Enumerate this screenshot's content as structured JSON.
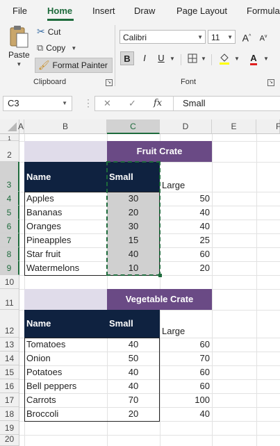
{
  "ribbon_tabs": [
    {
      "label": "File"
    },
    {
      "label": "Home"
    },
    {
      "label": "Insert"
    },
    {
      "label": "Draw"
    },
    {
      "label": "Page Layout"
    },
    {
      "label": "Formula"
    }
  ],
  "clipboard": {
    "paste": "Paste",
    "cut": "Cut",
    "copy": "Copy",
    "format_painter": "Format Painter",
    "group_label": "Clipboard"
  },
  "font": {
    "name": "Calibri",
    "size": "11",
    "grow": "A",
    "shrink": "A",
    "bold": "B",
    "italic": "I",
    "underline": "U",
    "color_letter": "A",
    "group_label": "Font"
  },
  "formula_bar": {
    "name_box": "C3",
    "cancel": "✕",
    "enter": "✓",
    "fx": "fx",
    "value": "Small"
  },
  "columns": [
    "A",
    "B",
    "C",
    "D",
    "E",
    "F"
  ],
  "rows": [
    "1",
    "2",
    "3",
    "4",
    "5",
    "6",
    "7",
    "8",
    "9",
    "10",
    "11",
    "12",
    "13",
    "14",
    "15",
    "16",
    "17",
    "18",
    "19",
    "20"
  ],
  "fruit": {
    "title": "Fruit Crate",
    "headers": [
      "Name",
      "Small",
      "Large"
    ],
    "rows": [
      {
        "name": "Apples",
        "small": "30",
        "large": "50"
      },
      {
        "name": "Bananas",
        "small": "20",
        "large": "40"
      },
      {
        "name": "Oranges",
        "small": "30",
        "large": "40"
      },
      {
        "name": "Pineapples",
        "small": "15",
        "large": "25"
      },
      {
        "name": "Star fruit",
        "small": "40",
        "large": "60"
      },
      {
        "name": "Watermelons",
        "small": "10",
        "large": "20"
      }
    ]
  },
  "veg": {
    "title": "Vegetable Crate",
    "headers": [
      "Name",
      "Small",
      "Large"
    ],
    "rows": [
      {
        "name": "Tomatoes",
        "small": "40",
        "large": "60"
      },
      {
        "name": "Onion",
        "small": "50",
        "large": "70"
      },
      {
        "name": "Potatoes",
        "small": "40",
        "large": "60"
      },
      {
        "name": "Bell peppers",
        "small": "40",
        "large": "60"
      },
      {
        "name": "Carrots",
        "small": "70",
        "large": "100"
      },
      {
        "name": "Broccoli",
        "small": "20",
        "large": "40"
      }
    ]
  },
  "colors": {
    "accent": "#1e6b3c",
    "header_navy": "#0f2240",
    "title_purple": "#6a4a85",
    "lavender": "#e0dcea"
  }
}
